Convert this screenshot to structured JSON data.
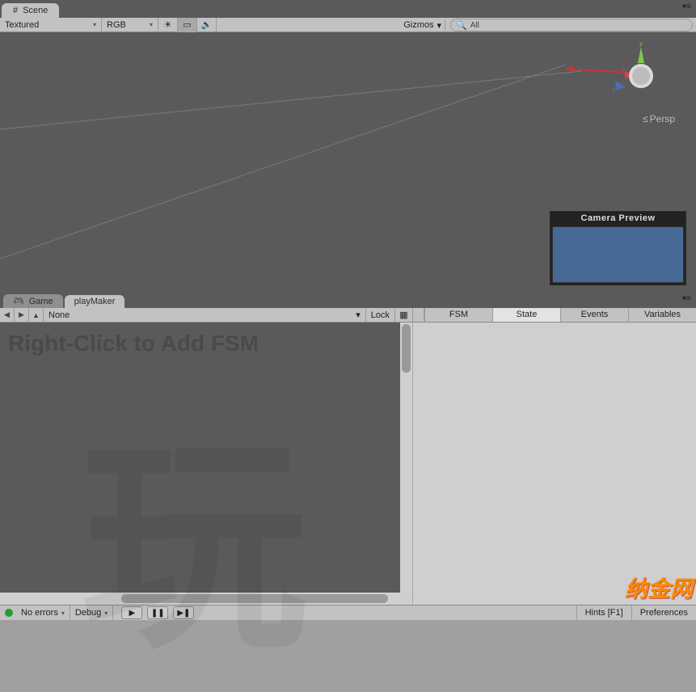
{
  "tabs": {
    "scene": "Scene",
    "game": "Game",
    "playmaker": "playMaker"
  },
  "sceneToolbar": {
    "drawMode": "Textured",
    "renderMode": "RGB",
    "gizmos": "Gizmos",
    "searchPrefix": "All"
  },
  "sceneView": {
    "projection": "Persp",
    "camPreview": "Camera Preview",
    "axes": {
      "x": "x",
      "y": "y",
      "z": "z"
    }
  },
  "pm": {
    "nav": {
      "back": "◀",
      "fwd": "▶",
      "up": "▲"
    },
    "dropdown": "None",
    "lock": "Lock",
    "tabs": {
      "fsm": "FSM",
      "state": "State",
      "events": "Events",
      "vars": "Variables"
    },
    "canvasHint": "Right-Click to Add FSM"
  },
  "status": {
    "errors": "No errors",
    "debug": "Debug",
    "hints": "Hints [F1]",
    "prefs": "Preferences"
  },
  "watermark": "玩",
  "watermark2": "纳金网"
}
